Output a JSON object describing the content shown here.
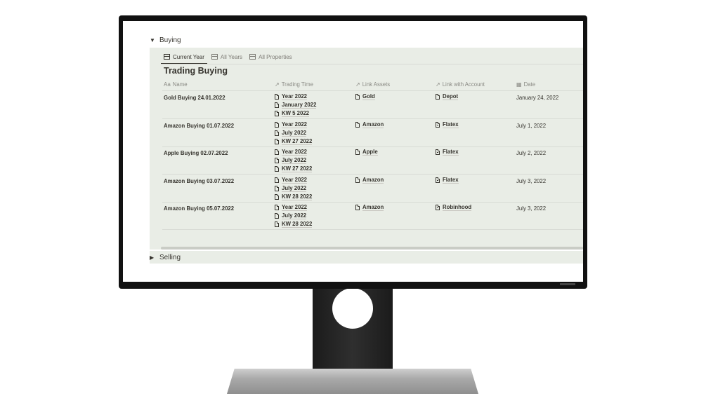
{
  "buying_section": {
    "toggle": "▼",
    "label": "Buying"
  },
  "tabs": [
    {
      "label": "Current Year",
      "active": true
    },
    {
      "label": "All Years",
      "active": false
    },
    {
      "label": "All Properties",
      "active": false
    }
  ],
  "db_title": "Trading Buying",
  "columns": {
    "name": "Name",
    "trading_time": "Trading Time",
    "link_assets": "Link Assets",
    "link_account": "Link with Account",
    "date": "Date"
  },
  "rows": [
    {
      "name": "Gold Buying 24.01.2022",
      "trading_time": [
        "Year 2022",
        "January 2022",
        "KW 5 2022"
      ],
      "asset": "Gold",
      "account": "Depot",
      "account_icon": "page-icon",
      "date": "January 24, 2022"
    },
    {
      "name": "Amazon Buying 01.07.2022",
      "trading_time": [
        "Year 2022",
        "July 2022",
        "KW 27 2022"
      ],
      "asset": "Amazon",
      "account": "Flatex",
      "account_icon": "document-icon",
      "date": "July 1, 2022"
    },
    {
      "name": "Apple Buying 02.07.2022",
      "trading_time": [
        "Year 2022",
        "July 2022",
        "KW 27 2022"
      ],
      "asset": "Apple",
      "account": "Flatex",
      "account_icon": "document-icon",
      "date": "July 2, 2022"
    },
    {
      "name": "Amazon Buying 03.07.2022",
      "trading_time": [
        "Year 2022",
        "July 2022",
        "KW 28 2022"
      ],
      "asset": "Amazon",
      "account": "Flatex",
      "account_icon": "document-icon",
      "date": "July 3, 2022"
    },
    {
      "name": "Amazon Buying 05.07.2022",
      "trading_time": [
        "Year 2022",
        "July 2022",
        "KW 28 2022"
      ],
      "asset": "Amazon",
      "account": "Robinhood",
      "account_icon": "document-icon",
      "date": "July 3, 2022"
    }
  ],
  "selling_section": {
    "toggle": "▶",
    "label": "Selling"
  },
  "colors": {
    "panel_bg": "#e9ede6",
    "text": "#37352f",
    "muted": "#8a8a84",
    "bezel": "#111111"
  }
}
